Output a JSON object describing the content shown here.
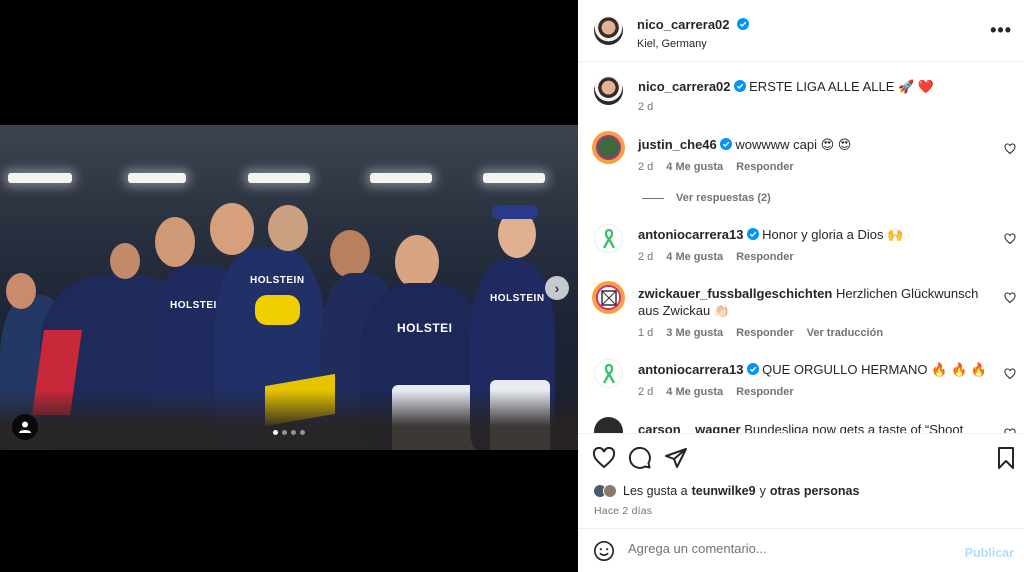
{
  "post": {
    "author": "nico_carrera02",
    "location": "Kiel, Germany",
    "more_icon": "more-horizontal-icon",
    "caption_user": "nico_carrera02",
    "caption_text": "ERSTE LIGA ALLE ALLE 🚀 ❤️",
    "caption_time": "2 d"
  },
  "media": {
    "jersey_text": "HOLSTEIN",
    "jersey_text_center": "HOLSTEI",
    "carousel_total": 4,
    "carousel_index": 1
  },
  "comments": [
    {
      "user": "justin_che46",
      "verified": true,
      "text": "wowwww capi 😍 😍",
      "time": "2 d",
      "likes": "4 Me gusta",
      "reply": "Responder",
      "view_replies": "Ver respuestas (2)"
    },
    {
      "user": "antoniocarrera13",
      "verified": true,
      "text": "Honor y gloria a Dios 🙌",
      "time": "2 d",
      "likes": "4 Me gusta",
      "reply": "Responder"
    },
    {
      "user": "zwickauer_fussballgeschichten",
      "verified": false,
      "text": "Herzlichen Glückwunsch aus Zwickau 👏🏻",
      "time": "1 d",
      "likes": "3 Me gusta",
      "reply": "Responder",
      "translate": "Ver traducción"
    },
    {
      "user": "antoniocarrera13",
      "verified": true,
      "text": "QUE ORGULLO HERMANO 🔥 🔥 🔥",
      "time": "2 d",
      "likes": "4 Me gusta",
      "reply": "Responder"
    },
    {
      "user": "carson__wagner",
      "verified": false,
      "text": "Bundesliga now gets a taste of “Shoot Nico"
    }
  ],
  "likes": {
    "prefix": "Les gusta a",
    "user": "teunwilke9",
    "conj": "y",
    "others": "otras personas"
  },
  "posted_ago": "Hace 2 días",
  "add_comment": {
    "placeholder": "Agrega un comentario...",
    "publish": "Publicar"
  },
  "colors": {
    "verified": "#0095f6",
    "heart_red": "#e0245e",
    "secondary_text": "#737373",
    "publish_disabled": "#b3dbff"
  }
}
